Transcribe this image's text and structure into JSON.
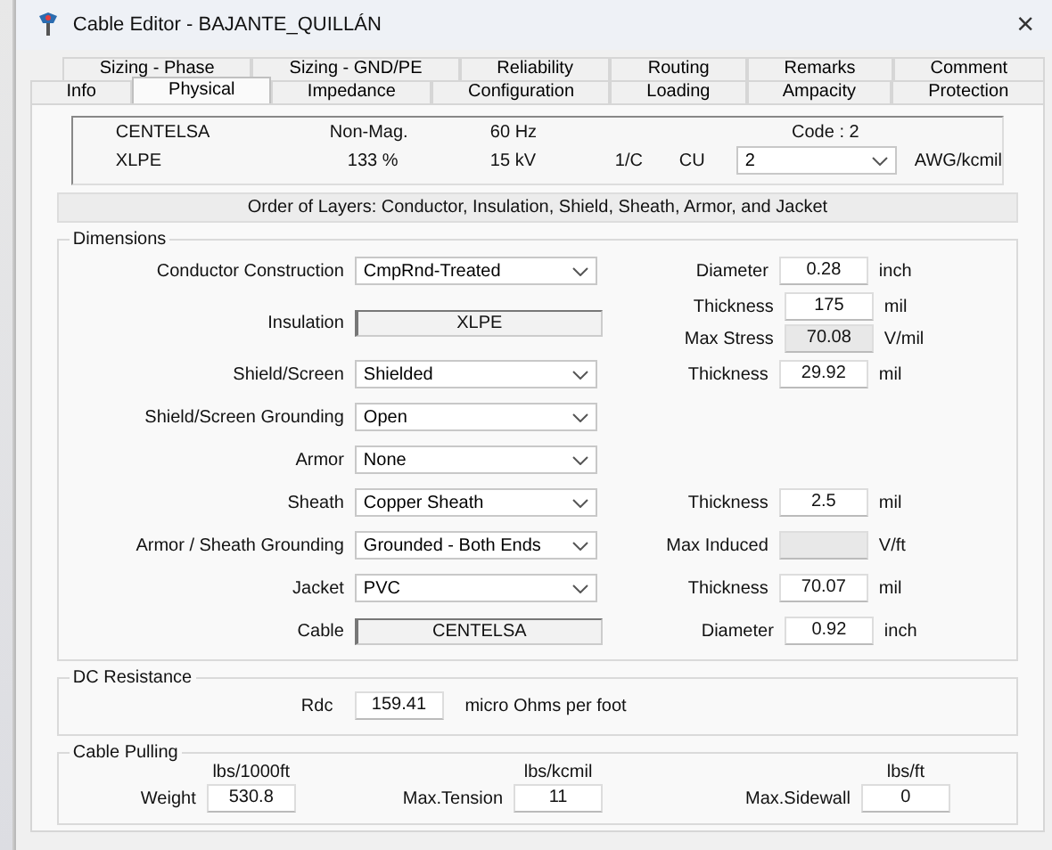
{
  "window": {
    "title": "Cable Editor - BAJANTE_QUILLÁN",
    "close": "×"
  },
  "tabs": [
    [
      {
        "label": "Sizing - Phase",
        "selected": false
      },
      {
        "label": "Sizing - GND/PE",
        "selected": false
      },
      {
        "label": "Reliability",
        "selected": false
      },
      {
        "label": "Routing",
        "selected": false
      },
      {
        "label": "Remarks",
        "selected": false
      },
      {
        "label": "Comment",
        "selected": false
      }
    ],
    [
      {
        "label": "Info",
        "selected": false
      },
      {
        "label": "Physical",
        "selected": true
      },
      {
        "label": "Impedance",
        "selected": false
      },
      {
        "label": "Configuration",
        "selected": false
      },
      {
        "label": "Loading",
        "selected": false
      },
      {
        "label": "Ampacity",
        "selected": false
      },
      {
        "label": "Protection",
        "selected": false
      }
    ]
  ],
  "summary": {
    "manufacturer": "CENTELSA",
    "magnetic": "Non-Mag.",
    "frequency": "60 Hz",
    "code": "Code : 2",
    "insulation": "XLPE",
    "insulation_level": "133 %",
    "voltage": "15 kV",
    "conductors": "1/C",
    "material": "CU",
    "size": "2",
    "size_unit": "AWG/kcmil"
  },
  "order_of_layers": "Order of Layers: Conductor, Insulation, Shield, Sheath, Armor, and Jacket",
  "dimensions": {
    "title": "Dimensions",
    "rows": [
      {
        "label": "Conductor Construction",
        "control": {
          "kind": "dropdown",
          "value": "CmpRnd-Treated"
        },
        "measures": [
          {
            "label": "Diameter",
            "value": "0.28",
            "unit": "inch",
            "disabled": false
          }
        ]
      },
      {
        "label": "Insulation",
        "control": {
          "kind": "display",
          "value": "XLPE"
        },
        "measures": [
          {
            "label": "Thickness",
            "value": "175",
            "unit": "mil",
            "disabled": false
          },
          {
            "label": "Max Stress",
            "value": "70.08",
            "unit": "V/mil",
            "disabled": true
          }
        ]
      },
      {
        "label": "Shield/Screen",
        "control": {
          "kind": "dropdown",
          "value": "Shielded"
        },
        "measures": [
          {
            "label": "Thickness",
            "value": "29.92",
            "unit": "mil",
            "disabled": false
          }
        ]
      },
      {
        "label": "Shield/Screen Grounding",
        "control": {
          "kind": "dropdown",
          "value": "Open"
        },
        "measures": []
      },
      {
        "label": "Armor",
        "control": {
          "kind": "dropdown",
          "value": "None"
        },
        "measures": []
      },
      {
        "label": "Sheath",
        "control": {
          "kind": "dropdown",
          "value": "Copper Sheath"
        },
        "measures": [
          {
            "label": "Thickness",
            "value": "2.5",
            "unit": "mil",
            "disabled": false
          }
        ]
      },
      {
        "label": "Armor / Sheath Grounding",
        "control": {
          "kind": "dropdown",
          "value": "Grounded - Both Ends"
        },
        "measures": [
          {
            "label": "Max Induced",
            "unit": "V/ft",
            "disabled": true
          }
        ]
      },
      {
        "label": "Jacket",
        "control": {
          "kind": "dropdown",
          "value": "PVC"
        },
        "measures": [
          {
            "label": "Thickness",
            "value": "70.07",
            "unit": "mil",
            "disabled": false
          }
        ]
      },
      {
        "label": "Cable",
        "control": {
          "kind": "display",
          "value": "CENTELSA"
        },
        "measures": [
          {
            "label": "Diameter",
            "value": "0.92",
            "unit": "inch",
            "disabled": false
          }
        ]
      }
    ]
  },
  "dc_resistance": {
    "title": "DC Resistance",
    "label": "Rdc",
    "value": "159.41",
    "unit": "micro Ohms per foot"
  },
  "cable_pulling": {
    "title": "Cable Pulling",
    "items": [
      {
        "unit": "lbs/1000ft",
        "label": "Weight",
        "value": "530.8"
      },
      {
        "unit": "lbs/kcmil",
        "label": "Max.Tension",
        "value": "11"
      },
      {
        "unit": "lbs/ft",
        "label": "Max.Sidewall",
        "value": "0"
      }
    ]
  }
}
